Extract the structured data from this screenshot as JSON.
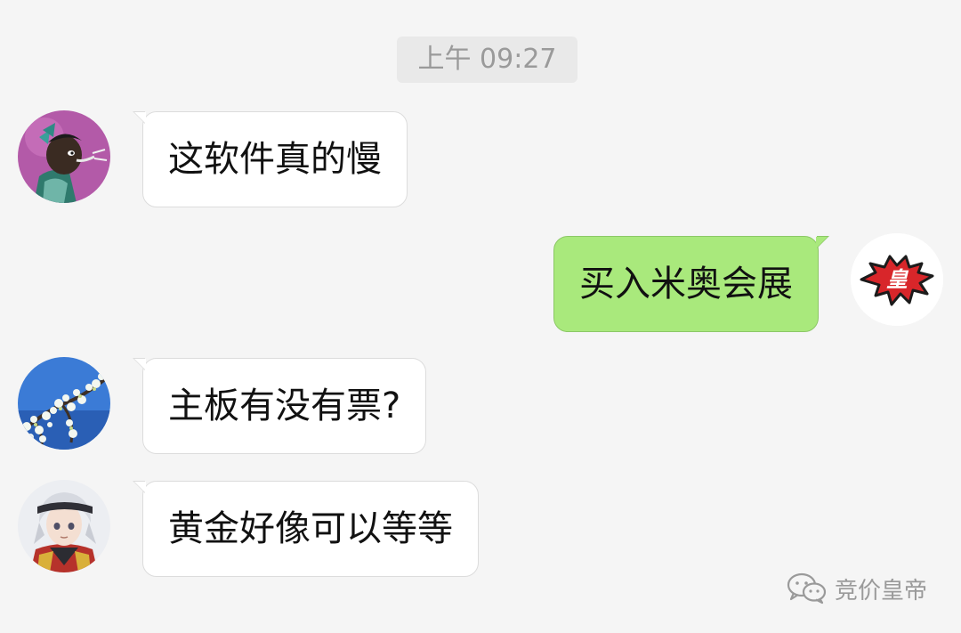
{
  "timestamp": "上午 09:27",
  "messages": [
    {
      "side": "left",
      "avatar": "avatar-cartoon-boy",
      "text": "这软件真的慢"
    },
    {
      "side": "right",
      "avatar": "avatar-emperor-badge",
      "text": "买入米奥会展",
      "badge_text": "皇"
    },
    {
      "side": "left",
      "avatar": "avatar-blossom-branch",
      "text": "主板有没有票?"
    },
    {
      "side": "left",
      "avatar": "avatar-anime-character",
      "text": "黄金好像可以等等"
    }
  ],
  "watermark": {
    "icon": "wechat-icon",
    "text": "竞价皇帝"
  },
  "colors": {
    "background": "#f5f5f5",
    "bubble_left": "#ffffff",
    "bubble_right": "#a9e97c",
    "badge_red": "#d8262a"
  }
}
